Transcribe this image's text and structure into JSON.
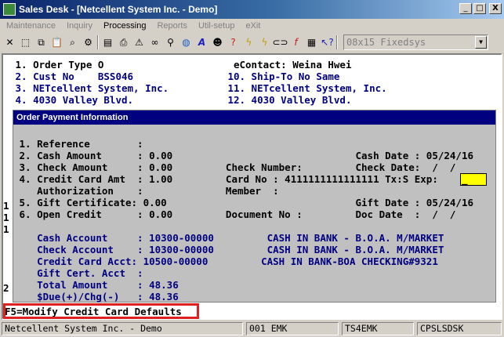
{
  "window": {
    "title": "Sales Desk - [Netcellent System Inc. - Demo]",
    "buttons": [
      "_",
      "□",
      "X"
    ]
  },
  "menu": [
    "Maintenance",
    "Inquiry",
    "Processing",
    "Reports",
    "Util-setup",
    "eXit"
  ],
  "toolbar": {
    "icons": [
      "new-icon",
      "select-icon",
      "copy-icon",
      "paste-icon",
      "find-icon",
      "settings-icon",
      "note-icon",
      "print-icon",
      "warning-icon",
      "binoculars-icon",
      "search-icon",
      "globe-icon",
      "font-icon",
      "user-icon",
      "help-icon",
      "lightning-icon",
      "lightning2-icon",
      "link-icon",
      "function-icon",
      "calendar-icon",
      "help-pointer-icon"
    ],
    "font_select": "08x15 Fixedsys"
  },
  "header": {
    "line1": " 1. Order Type O                      eContact: Weina Hwei",
    "line2": " 2. Cust No    BSS046                10. Ship-To No Same",
    "line3": " 3. NETcellent System, Inc.          11. NETcellent System, Inc.",
    "line4": " 4. 4030 Valley Blvd.                12. 4030 Valley Blvd."
  },
  "popup": {
    "title": "Order Payment Information",
    "lines": [
      " 1. Reference        :",
      " 2. Cash Amount      : 0.00                               Cash Date : 05/24/16",
      " 3. Check Amount     : 0.00         Check Number:         Check Date:  /  /",
      " 4. Credit Card Amt  : 1.00         Card No : 4111111111111111 Tx:S Exp:",
      "    Authorization    :              Member  :",
      " 5. Gift Certificate: 0.00                                Gift Date : 05/24/16",
      " 6. Open Credit      : 0.00         Document No :         Doc Date  :  /  /",
      "",
      "    Cash Account     : 10300-00000         CASH IN BANK - B.O.A. M/MARKET",
      "    Check Account    : 10300-00000         CASH IN BANK - B.O.A. M/MARKET",
      "    Credit Card Acct: 10500-00000         CASH IN BANK-BOA CHECKING#9321",
      "    Gift Cert. Acct  :",
      "    Total Amount     : 48.36",
      "    $Due(+)/Chg(-)   : 48.36"
    ],
    "exp_value": "_"
  },
  "left_margin": [
    "1",
    "1",
    "1",
    "2"
  ],
  "fkey": "F5=Modify Credit Card Defaults",
  "status": {
    "company": "Netcellent System Inc. - Demo",
    "user": "001 EMK",
    "station": "TS4EMK",
    "program": "CPSLSDSK"
  }
}
